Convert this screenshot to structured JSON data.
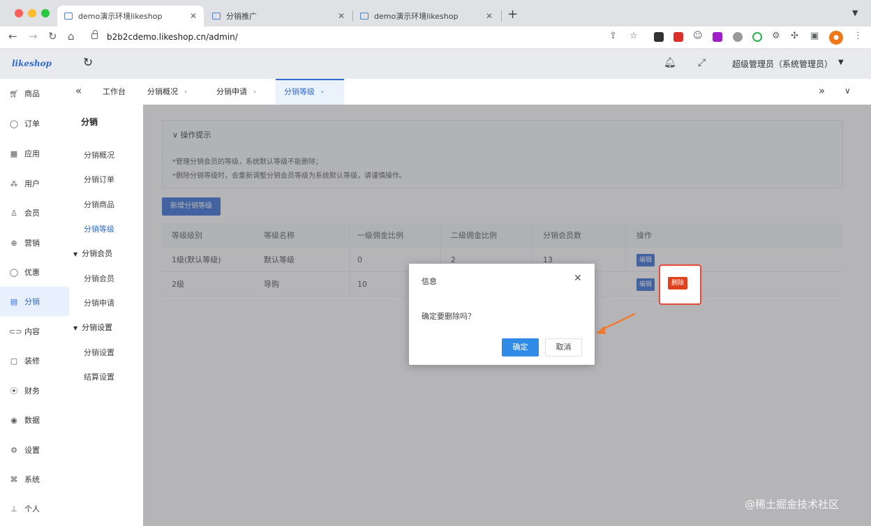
{
  "browser": {
    "tabs": [
      {
        "title": "demo演示环境likeshop"
      },
      {
        "title": "分销推广"
      },
      {
        "title": "demo演示环境likeshop"
      }
    ],
    "url": "b2b2cdemo.likeshop.cn/admin/"
  },
  "app": {
    "logo": "likeshop",
    "user": "超级管理员（系统管理员）",
    "nav": [
      "商品",
      "订单",
      "应用",
      "用户",
      "会员",
      "营销",
      "优惠",
      "分销",
      "内容",
      "装修",
      "财务",
      "数据",
      "设置",
      "系统",
      "个人"
    ],
    "nav_icons": [
      "cart-icon",
      "order-icon",
      "app-icon",
      "user-icon",
      "member-icon",
      "marketing-icon",
      "coupon-icon",
      "distribution-icon",
      "content-icon",
      "decoration-icon",
      "finance-icon",
      "data-icon",
      "settings-icon",
      "system-icon",
      "person-icon"
    ],
    "subnav": {
      "heading": "分销",
      "items": [
        "分销概况",
        "分销订单",
        "分销商品",
        "分销等级"
      ],
      "group1": "分销会员",
      "group1_items": [
        "分销会员",
        "分销申请"
      ],
      "group2": "分销设置",
      "group2_items": [
        "分销设置",
        "结算设置"
      ]
    },
    "tabs": [
      "工作台",
      "分销概况",
      "分销申请",
      "分销等级"
    ],
    "tips": {
      "title": "操作提示",
      "lines": [
        "*管理分销会员的等级，系统默认等级不能删除；",
        "*删除分销等级时，会重新调整分销会员等级为系统默认等级，请谨慎操作。"
      ]
    },
    "add_button": "新增分销等级",
    "table": {
      "headers": [
        "等级级别",
        "等级名称",
        "一级佣金比例",
        "二级佣金比例",
        "分销会员数",
        "操作"
      ],
      "rows": [
        {
          "level": "1级(默认等级)",
          "name": "默认等级",
          "first": "0",
          "second": "2",
          "members": "13",
          "edit": "编辑"
        },
        {
          "level": "2级",
          "name": "导购",
          "first": "10",
          "second": "",
          "members": "",
          "edit": "编辑",
          "delete": "删除"
        }
      ]
    },
    "dialog": {
      "title": "信息",
      "message": "确定要删除吗？",
      "ok": "确定",
      "cancel": "取消"
    },
    "watermark": "@稀土掘金技术社区",
    "colors": {
      "accent": "#2f6ad1",
      "danger": "#e0421d",
      "highlight": "#e8483a",
      "arrow": "#f07a30"
    }
  }
}
